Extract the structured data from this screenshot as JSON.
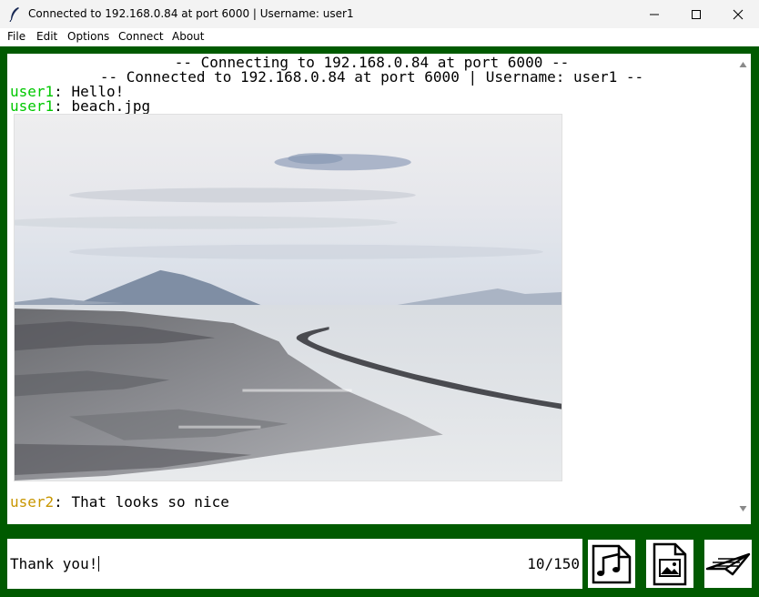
{
  "window": {
    "title": "Connected to 192.168.0.84 at port 6000 | Username: user1"
  },
  "menu": {
    "items": [
      "File",
      "Edit",
      "Options",
      "Connect",
      "About"
    ]
  },
  "chat": {
    "system_lines": [
      "-- Connecting to 192.168.0.84 at port 6000 --",
      "-- Connected to 192.168.0.84 at port 6000 | Username: user1 --"
    ],
    "messages": [
      {
        "user": "user1",
        "separator": ":",
        "text": " Hello!"
      },
      {
        "user": "user1",
        "separator": ":",
        "text": " beach.jpg"
      },
      {
        "user": "user2",
        "separator": ":",
        "text": " That looks so nice"
      }
    ]
  },
  "input": {
    "value": "Thank you!",
    "char_count": "10/150"
  },
  "buttons": {
    "music_icon": "music-file-icon",
    "image_icon": "image-file-icon",
    "send_icon": "paper-plane-icon"
  },
  "colors": {
    "frame": "#005a00",
    "user1": "#00c800",
    "user2": "#c89600"
  }
}
